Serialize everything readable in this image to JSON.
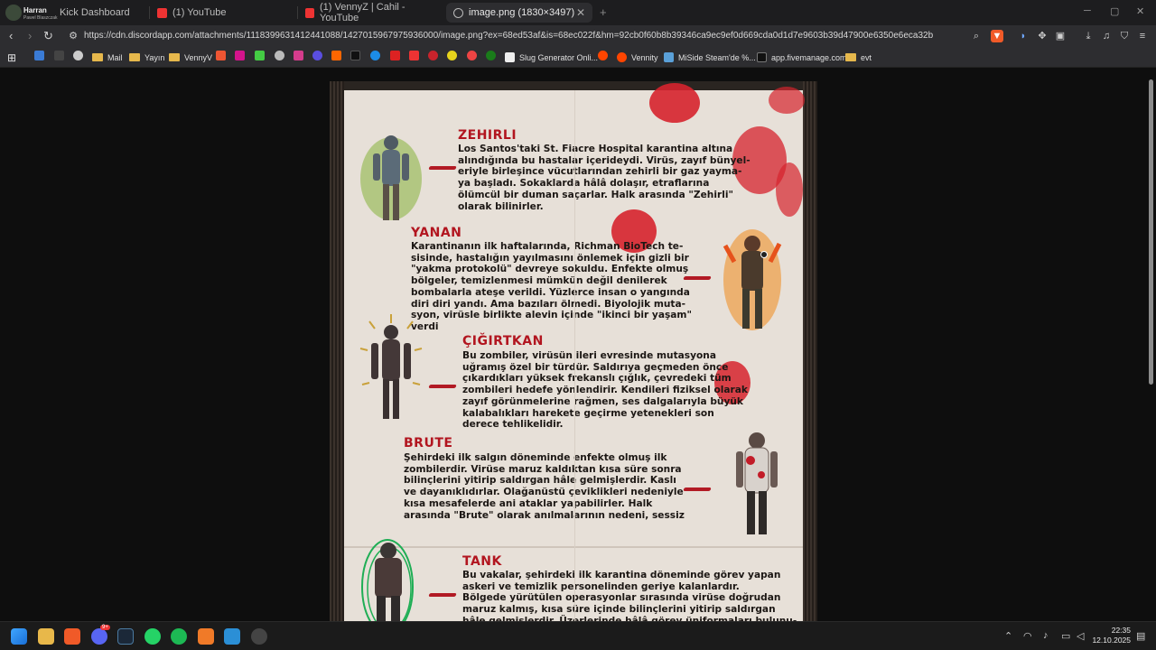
{
  "browser": {
    "tabs": [
      {
        "label": "Kick Dashboard",
        "overlay_title": "Harran",
        "overlay_sub": "Pawel Blaszczak"
      },
      {
        "label": "(1) YouTube"
      },
      {
        "label": "(1) VennyZ | Cahil - YouTube"
      },
      {
        "label": "image.png (1830×3497)",
        "active": true
      }
    ],
    "url": "https://cdn.discordapp.com/attachments/1118399631412441088/1427015967975936000/image.png?ex=68ed53af&is=68ec022f&hm=92cb0f60b8b39346ca9ec9ef0d669cda0d1d7e9603b39d47900e6350e6eca32b",
    "bookmarks": [
      "Mail",
      "Yayın",
      "VennyV",
      "Slug Generator Onli...",
      "Vennity",
      "MiSide Steam'de %...",
      "app.fivemanage.com",
      "evt"
    ],
    "accent": "#d6232e"
  },
  "poster": {
    "entries": [
      {
        "title": "ZEHIRLI",
        "text": "Los Santos'taki St. Fiacre Hospital karantina altına\nalındığında bu hastalar içerideydi. Virüs, zayıf bünyel-\neriyle birleşince vücutlarından zehirli bir gaz yayma-\nya başladı. Sokaklarda hâlâ dolaşır, etraflarına\nölümcül bir duman saçarlar. Halk arasında \"Zehirli\"\nolarak bilinirler."
      },
      {
        "title": "YANAN",
        "text": "Karantinanın ilk haftalarında, Richman BioTech te-\nsisinde, hastalığın yayılmasını önlemek için gizli bir\n\"yakma protokolü\" devreye sokuldu. Enfekte olmuş\nbölgeler, temizlenmesi mümkün değil denilerek\nbombalarla ateşe verildi. Yüzlerce insan o yangında\ndiri diri yandı. Ama bazıları ölmedi. Biyolojik muta-\nsyon, virüsle birlikte alevin içinde \"ikinci bir yaşam\"\nverdi"
      },
      {
        "title": "ÇIĞIRTKAN",
        "text": "Bu zombiler, virüsün ileri evresinde mutasyona\nuğramış özel bir türdür. Saldırıya geçmeden önce\nçıkardıkları yüksek frekanslı çığlık, çevredeki tüm\nzombileri hedefe yönlendirir. Kendileri fiziksel olarak\nzayıf görünmelerine rağmen, ses dalgalarıyla büyük\nkalabalıkları harekete geçirme yetenekleri son\nderece tehlikelidir."
      },
      {
        "title": "BRUTE",
        "text": "Şehirdeki ilk salgın döneminde enfekte olmuş ilk\nzombilerdir. Virüse maruz kaldıktan kısa süre sonra\nbilinçlerini yitirip saldırgan hâle gelmişlerdir. Kaslı\nve dayanıklıdırlar. Olağanüstü çeviklikleri nedeniyle\nkısa mesafelerde ani ataklar yapabilirler. Halk\narasında \"Brute\" olarak anılmalarının nedeni, sessiz"
      },
      {
        "title": "TANK",
        "text": "Bu vakalar, şehirdeki ilk karantina döneminde görev yapan\naskeri ve temizlik personelinden geriye kalanlardır.\nBölgede yürütülen operasyonlar sırasında virüse doğrudan\nmaruz kalmış, kısa süre içinde bilinçlerini yitirip saldırgan\nhâle gelmişlerdir. Üzerlerinde hâlâ görev üniformaları bulunu-"
      }
    ]
  },
  "taskbar": {
    "time": "22:35",
    "date": "12.10.2025",
    "badge": "9+"
  }
}
